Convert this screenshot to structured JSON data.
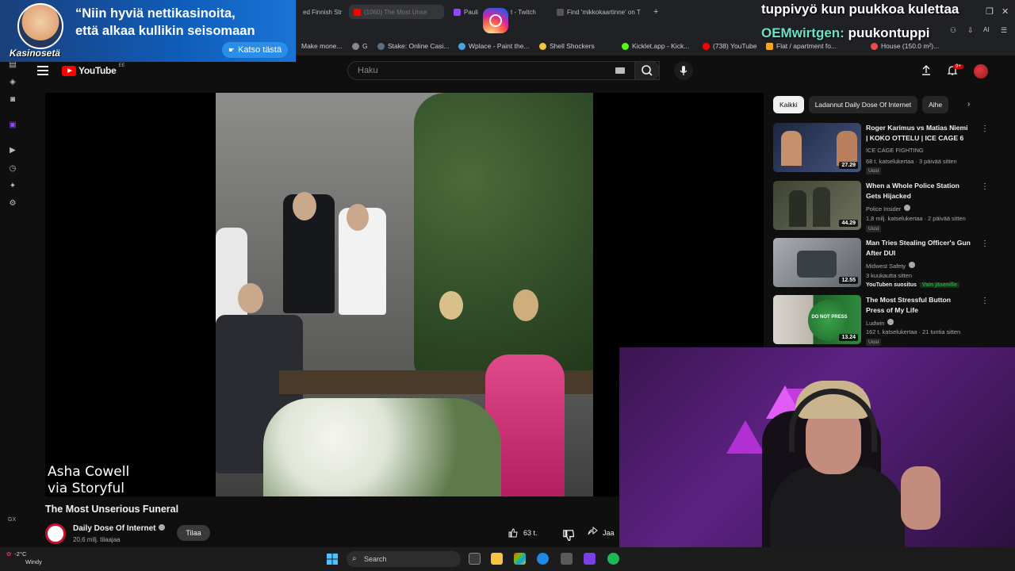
{
  "browser": {
    "tabs": [
      {
        "label": "ed Finnish Str",
        "color": "#6a5acd"
      },
      {
        "label": "(1060) The Most Unse",
        "color": "#ff0000",
        "active": true
      },
      {
        "label": "Pauli",
        "color": "#9146ff"
      },
      {
        "label": "t - Twitch",
        "color": "#9146ff"
      },
      {
        "label": "Find 'mikkokaartinne' on T",
        "color": "#888888"
      }
    ],
    "new_tab": "+",
    "bookmarks": [
      {
        "label": "Make mone...",
        "color": "#777777"
      },
      {
        "label": "G",
        "color": "#888888"
      },
      {
        "label": "Stake: Online Casi...",
        "color": "#1a2c38"
      },
      {
        "label": "Wplace - Paint the...",
        "color": "#4aa3df"
      },
      {
        "label": "Shell Shockers",
        "color": "#f4c542"
      },
      {
        "label": "Kicklet.app - Kick...",
        "color": "#53fc18"
      },
      {
        "label": "(738) YouTube",
        "color": "#ff0000"
      },
      {
        "label": "Flat / apartment fo...",
        "color": "#f5a623"
      },
      {
        "label": "House (150.0 m²)...",
        "color": "#e84e4e"
      }
    ]
  },
  "youtube": {
    "logo_text": "YouTube",
    "logo_country": "EE",
    "search_placeholder": "Haku",
    "notification_count": "9+",
    "video": {
      "title": "The Most Unserious Funeral",
      "credit_line1": "Asha Cowell",
      "credit_line2": "via Storyful",
      "channel": "Daily Dose Of Internet",
      "subscribers": "20,6 milj. tilaajaa",
      "subscribe_label": "Tilaa",
      "likes": "63 t.",
      "share_label": "Jaa"
    },
    "chips": [
      "Kaikki",
      "Ladannut Daily Dose Of Internet",
      "Aihe"
    ],
    "recommendations": [
      {
        "title_line1": "Roger Karimus vs Matias Niemi",
        "title_line2": "| KOKO OTTELU | ICE CAGE 6",
        "channel": "ICE CAGE FIGHTING",
        "meta": "68 t. katselukertaa · 3 päivää sitten",
        "tag": "Uusi",
        "duration": "27.29",
        "thumb_color": "#2a3550"
      },
      {
        "title_line1": "When a Whole Police Station",
        "title_line2": "Gets Hijacked",
        "channel": "Police Insider",
        "meta": "1,8 milj. katselukertaa · 2 päivää sitten",
        "tag": "Uusi",
        "duration": "44.29",
        "thumb_color": "#5a5f4e"
      },
      {
        "title_line1": "Man Tries Stealing Officer's Gun",
        "title_line2": "After DUI",
        "channel": "Midwest Safety",
        "meta": "3 kuukautta sitten",
        "tag": "YouTuben suositus",
        "members": "Vain jäsenille",
        "duration": "12.55",
        "thumb_color": "#8a8d92"
      },
      {
        "title_line1": "The Most Stressful Button",
        "title_line2": "Press of My Life",
        "channel": "Ludwin",
        "meta": "162 t. katselukertaa · 21 tuntia sitten",
        "tag": "Uusi",
        "duration": "13.24",
        "thumb_color": "#2f7d3a",
        "thumb_text": "DO NOT PRESS"
      }
    ]
  },
  "overlay": {
    "ad_line1": "“Niin hyviä nettikasinoita,",
    "ad_line2": "että alkaa kullikin seisomaan",
    "ad_brand": "Kasinosetä",
    "ad_button": "Katso tästä",
    "chat_message1": "tuppivyö kun puukkoa kulettaa",
    "chat_user2": "OEMwirtgen:",
    "chat_message2": "puukontuppi"
  },
  "sidebar": {
    "gx_label": "GX"
  },
  "taskbar": {
    "temperature": "-2°C",
    "weather": "Windy",
    "search_label": "Search"
  }
}
